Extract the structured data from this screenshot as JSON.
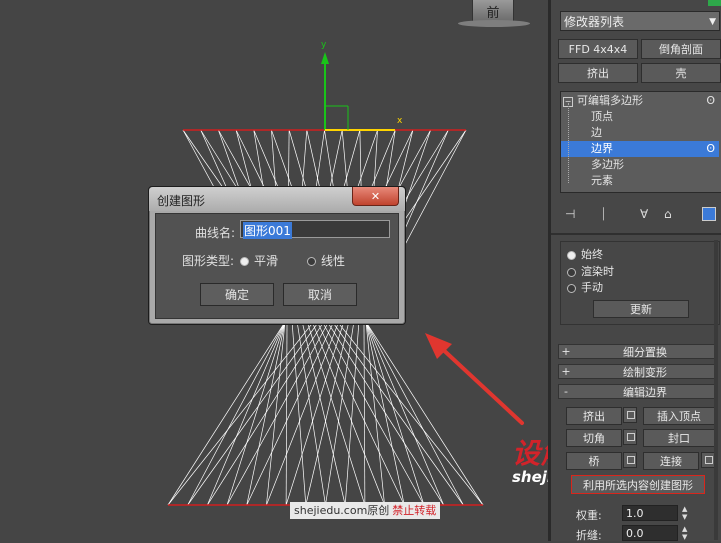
{
  "viewport": {
    "cube_label": "前",
    "axis_x": "x",
    "axis_y": "y"
  },
  "modifier_list": "修改器列表",
  "buttons": {
    "ffd": "FFD 4x4x4",
    "chamfer": "倒角剖面",
    "extrude": "挤出",
    "shell": "壳"
  },
  "stack": {
    "root": "可编辑多边形",
    "items": [
      "顶点",
      "边",
      "边界",
      "多边形",
      "元素"
    ],
    "selected": "边界"
  },
  "update_group": {
    "opt1": "始终",
    "opt2": "渲染时",
    "opt3": "手动",
    "button": "更新"
  },
  "rollouts": {
    "subdiv_disp": "细分置换",
    "paint_deform": "绘制变形",
    "edit_border": "编辑边界"
  },
  "edit_border": {
    "extrude": "挤出",
    "insert_vertex": "插入顶点",
    "chamfer": "切角",
    "cap": "封口",
    "bridge": "桥",
    "connect": "连接",
    "create_shape": "利用所选内容创建图形",
    "weight_label": "权重:",
    "weight_value": "1.0",
    "crease_label": "折缝:",
    "crease_value": "0.0"
  },
  "dialog": {
    "title": "创建图形",
    "close": "✕",
    "curve_name_label": "曲线名:",
    "curve_name_value": "图形001",
    "shape_type_label": "图形类型:",
    "smooth": "平滑",
    "linear": "线性",
    "ok": "确定",
    "cancel": "取消"
  },
  "watermark": {
    "logo": "设解读",
    "url": "shejiedu.com",
    "footer_site": "shejiedu.com原创",
    "footer_warn": "禁止转载"
  },
  "colors": {
    "highlight": "#3b7ad8",
    "arrow": "#e0362f",
    "axis_x": "#ffd400",
    "axis_y": "#19c419",
    "wire": "#ffffff",
    "edge": "#d11f1f"
  }
}
